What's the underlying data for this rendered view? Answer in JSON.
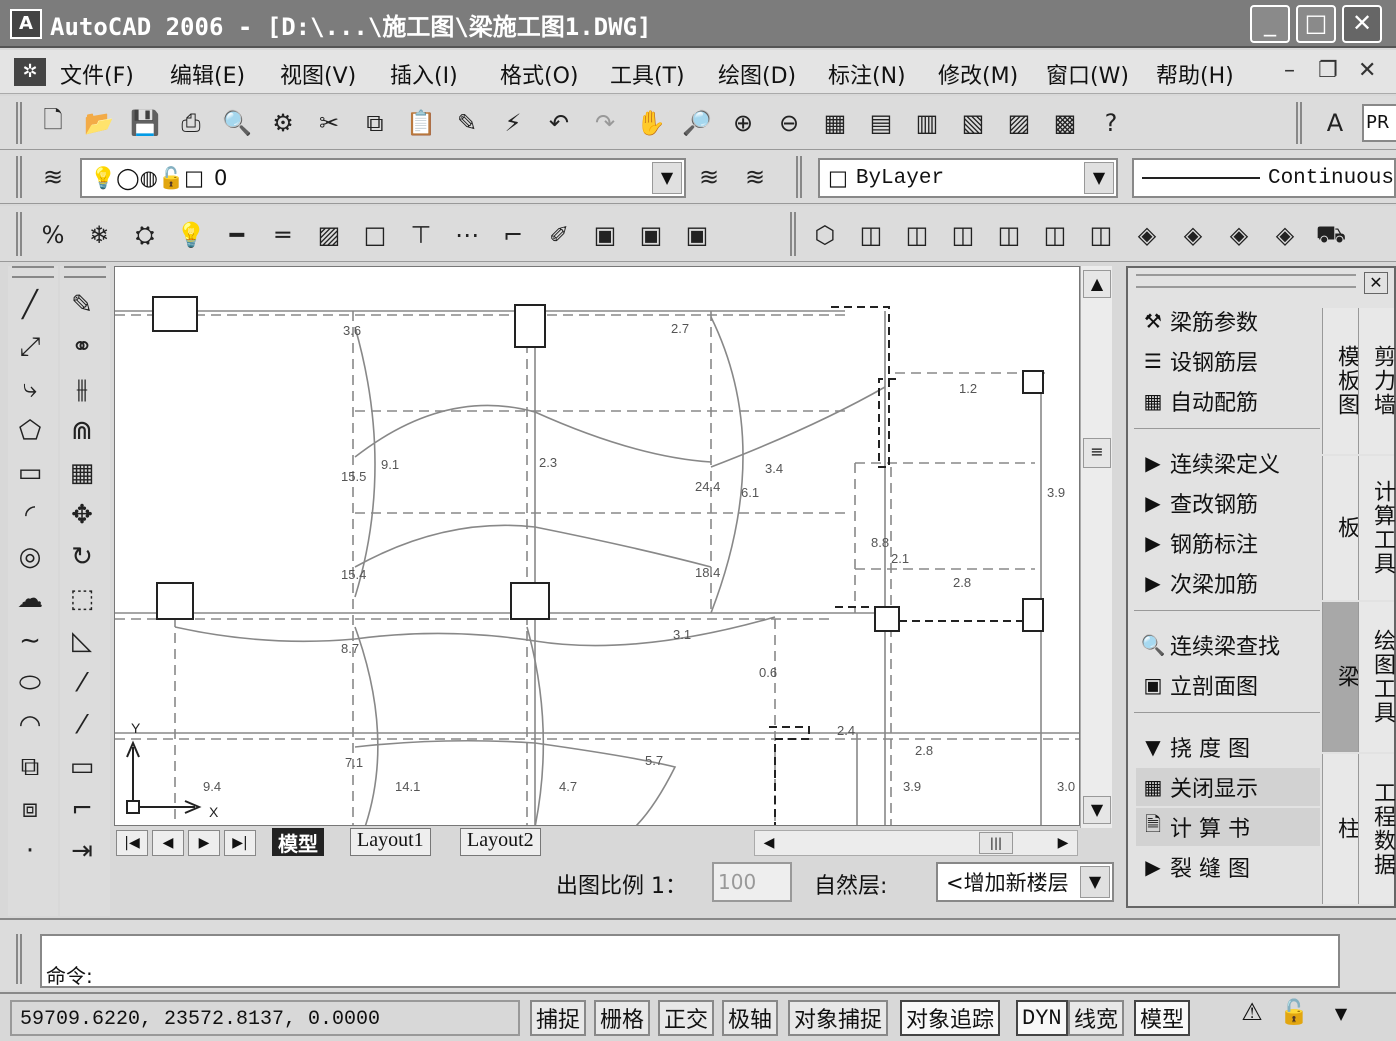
{
  "window": {
    "title": "AutoCAD 2006 - [D:\\...\\施工图\\梁施工图1.DWG]",
    "minimize": "_",
    "maximize": "□",
    "close": "✕"
  },
  "menu": {
    "items": [
      "文件(F)",
      "编辑(E)",
      "视图(V)",
      "插入(I)",
      "格式(O)",
      "工具(T)",
      "绘图(D)",
      "标注(N)",
      "修改(M)",
      "窗口(W)",
      "帮助(H)"
    ],
    "mdi_min": "–",
    "mdi_restore": "❐",
    "mdi_close": "✕"
  },
  "toolbar2": {
    "layer_value": "0",
    "color_value": "ByLayer",
    "linetype_value": "Continuous",
    "pen_label": "PR"
  },
  "tabs": {
    "model": "模型",
    "layout1": "Layout1",
    "layout2": "Layout2"
  },
  "scale": {
    "label": "出图比例 1：",
    "value": "100",
    "floor_label": "自然层:",
    "floor_value": "<增加新楼层"
  },
  "panel": {
    "group1": [
      "梁筋参数",
      "设钢筋层",
      "自动配筋"
    ],
    "group2": [
      "连续梁定义",
      "查改钢筋",
      "钢筋标注",
      "次梁加筋"
    ],
    "group3": [
      "连续梁查找",
      "立剖面图"
    ],
    "group4": [
      "挠 度 图",
      "关闭显示",
      "计 算 书",
      "裂 缝 图"
    ],
    "tabs_col1": [
      "模板图",
      "板",
      "梁",
      "柱"
    ],
    "tabs_col2": [
      "剪力墙",
      "计算工具",
      "绘图工具",
      "工程数据"
    ],
    "close": "✕"
  },
  "command": {
    "prompt": "命令:"
  },
  "status": {
    "coords": "59709.6220,  23572.8137,  0.0000",
    "toggles": [
      "捕捉",
      "栅格",
      "正交",
      "极轴",
      "对象捕捉",
      "对象追踪",
      "DYN",
      "线宽",
      "模型"
    ]
  },
  "drawing_labels": [
    "3.6",
    "2.7",
    "1.2",
    "15.5",
    "9.1",
    "2.3",
    "24.4",
    "6.1",
    "3.4",
    "3.9",
    "15.4",
    "18.4",
    "8.8",
    "2.1",
    "2.8",
    "8.7",
    "3.1",
    "0.6",
    "7.1",
    "14.1",
    "4.7",
    "5.7",
    "9.4",
    "2.8",
    "3.9",
    "3.0",
    "2.4"
  ],
  "ucs": {
    "x": "X",
    "y": "Y"
  }
}
